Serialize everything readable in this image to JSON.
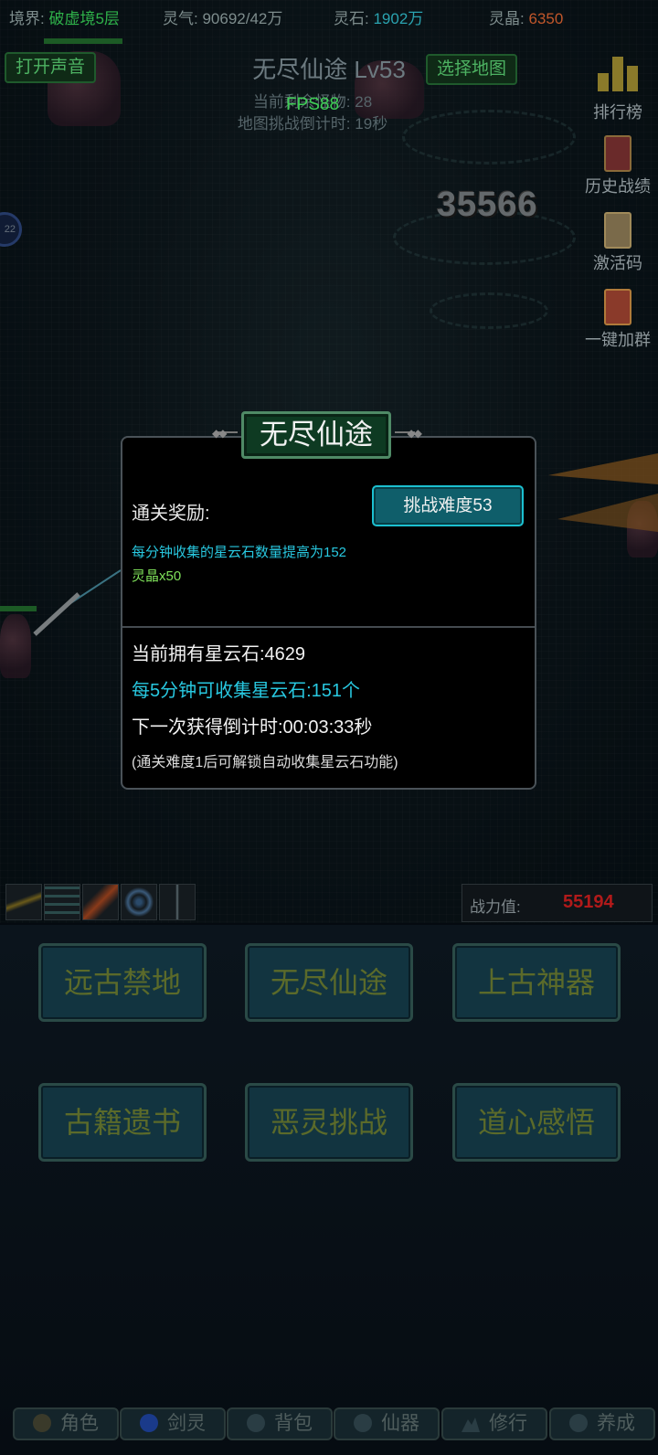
{
  "status": {
    "realm_label": "境界:",
    "realm_value": "破虚境5层",
    "qi_label": "灵气:",
    "qi_value": "90692/42万",
    "stone_label": "灵石:",
    "stone_value": "1902万",
    "crystal_label": "灵晶:",
    "crystal_value": "6350",
    "colors": {
      "realm": "#2fb24a",
      "stone": "#2aa3b0",
      "crystal": "#c0562a"
    }
  },
  "top": {
    "sound_button": "打开声音",
    "map_button": "选择地图",
    "map_title": "无尽仙途 Lv53",
    "fps": "FPS88",
    "remaining_monsters": "当前剩余怪物: 28",
    "challenge_timer": "地图挑战倒计时: 19秒"
  },
  "side_menu": [
    {
      "label": "排行榜",
      "icon": "bar-chart-icon"
    },
    {
      "label": "历史战绩",
      "icon": "record-book-icon"
    },
    {
      "label": "激活码",
      "icon": "scroll-icon"
    },
    {
      "label": "一键加群",
      "icon": "group-scroll-icon"
    }
  ],
  "field": {
    "damage_number": "35566",
    "badge": "22"
  },
  "dialog": {
    "title": "无尽仙途",
    "reward_label": "通关奖励:",
    "challenge_button": "挑战难度53",
    "reward_1": "每分钟收集的星云石数量提高为152",
    "reward_2": "灵晶x50",
    "owned": "当前拥有星云石:4629",
    "collect_rate": "每5分钟可收集星云石:151个",
    "countdown": "下一次获得倒计时:00:03:33秒",
    "note": "(通关难度1后可解锁自动收集星云石功能)"
  },
  "power": {
    "label": "战力值:",
    "value": "55194"
  },
  "skills": [
    "sword-skill-icon",
    "wind-skill-icon",
    "feather-skill-icon",
    "vortex-skill-icon",
    "blade-skill-icon"
  ],
  "modes": [
    "远古禁地",
    "无尽仙途",
    "上古神器",
    "古籍遗书",
    "恶灵挑战",
    "道心感悟"
  ],
  "tabs": [
    {
      "label": "角色",
      "icon": "character-icon"
    },
    {
      "label": "剑灵",
      "icon": "sword-spirit-icon"
    },
    {
      "label": "背包",
      "icon": "bag-icon"
    },
    {
      "label": "仙器",
      "icon": "artifact-icon"
    },
    {
      "label": "修行",
      "icon": "mountain-icon"
    },
    {
      "label": "养成",
      "icon": "cultivate-icon"
    }
  ]
}
